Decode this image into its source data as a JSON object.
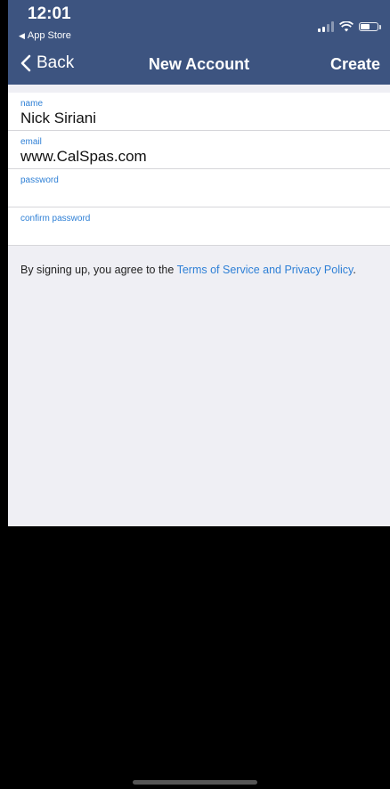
{
  "status_bar": {
    "time": "12:01",
    "back_app_label": "App Store"
  },
  "nav": {
    "back_label": "Back",
    "title": "New Account",
    "create_label": "Create"
  },
  "form": {
    "fields": [
      {
        "label": "name",
        "value": "Nick Siriani"
      },
      {
        "label": "email",
        "value": "www.CalSpas.com"
      },
      {
        "label": "password",
        "value": ""
      },
      {
        "label": "confirm password",
        "value": ""
      }
    ]
  },
  "terms": {
    "prefix": "By signing up, you agree to the ",
    "link": "Terms of Service and Privacy Policy",
    "suffix": "."
  },
  "colors": {
    "header_bg": "#3d5480",
    "accent": "#2f80d6",
    "page_bg": "#efeff4"
  }
}
